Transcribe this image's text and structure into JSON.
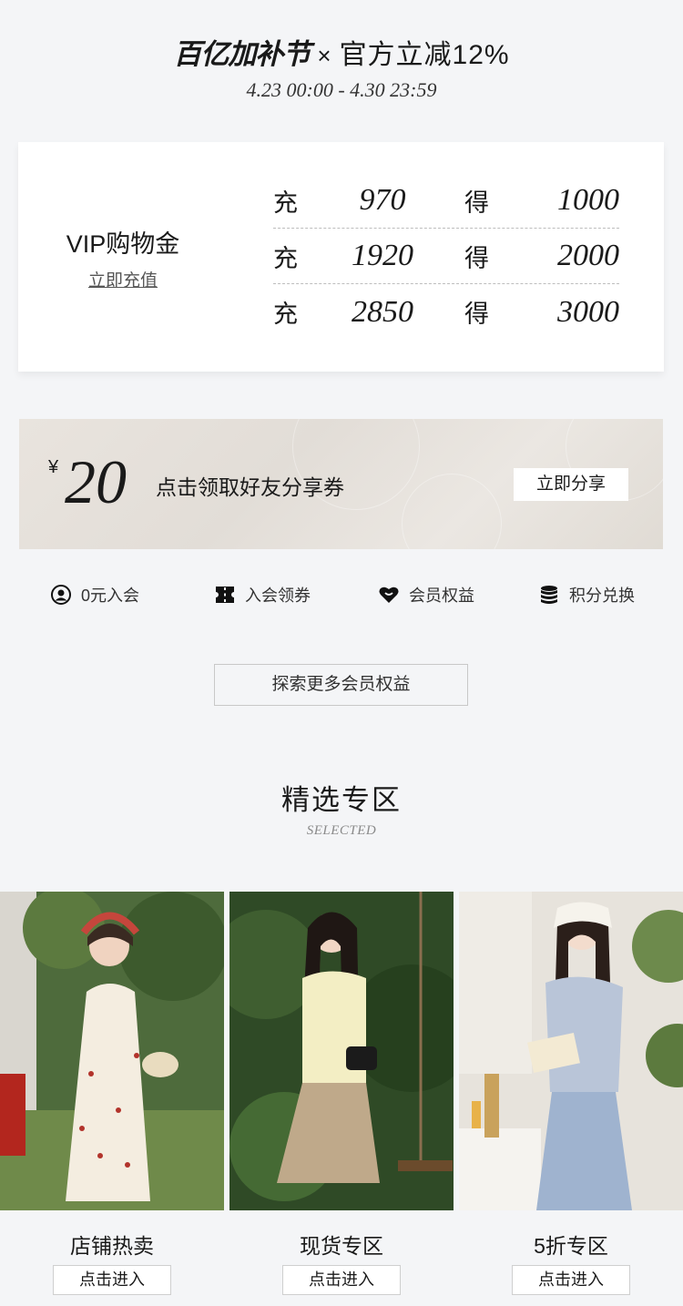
{
  "header": {
    "brand": "百亿加补节",
    "times": "×",
    "slogan": "官方立减12%",
    "date_range": "4.23 00:00 - 4.30 23:59"
  },
  "vip": {
    "title": "VIP购物金",
    "recharge_link": "立即充值",
    "tiers": [
      {
        "pay_label": "充",
        "pay": "970",
        "get_label": "得",
        "get": "1000"
      },
      {
        "pay_label": "充",
        "pay": "1920",
        "get_label": "得",
        "get": "2000"
      },
      {
        "pay_label": "充",
        "pay": "2850",
        "get_label": "得",
        "get": "3000"
      }
    ]
  },
  "coupon": {
    "currency": "¥",
    "amount": "20",
    "text": "点击领取好友分享券",
    "button": "立即分享"
  },
  "benefits": [
    {
      "icon": "user-circle-icon",
      "label": "0元入会"
    },
    {
      "icon": "ticket-icon",
      "label": "入会领券"
    },
    {
      "icon": "heart-badge-icon",
      "label": "会员权益"
    },
    {
      "icon": "coin-stack-icon",
      "label": "积分兑换"
    }
  ],
  "explore_button": "探索更多会员权益",
  "section": {
    "title": "精选专区",
    "subtitle": "SELECTED"
  },
  "cards": [
    {
      "name": "店铺热卖",
      "button": "点击进入"
    },
    {
      "name": "现货专区",
      "button": "点击进入"
    },
    {
      "name": "5折专区",
      "button": "点击进入"
    }
  ],
  "colors": {
    "background": "#f4f5f7",
    "card": "#ffffff",
    "coupon_bg": "#e6e1db",
    "text": "#1a1a1a"
  }
}
